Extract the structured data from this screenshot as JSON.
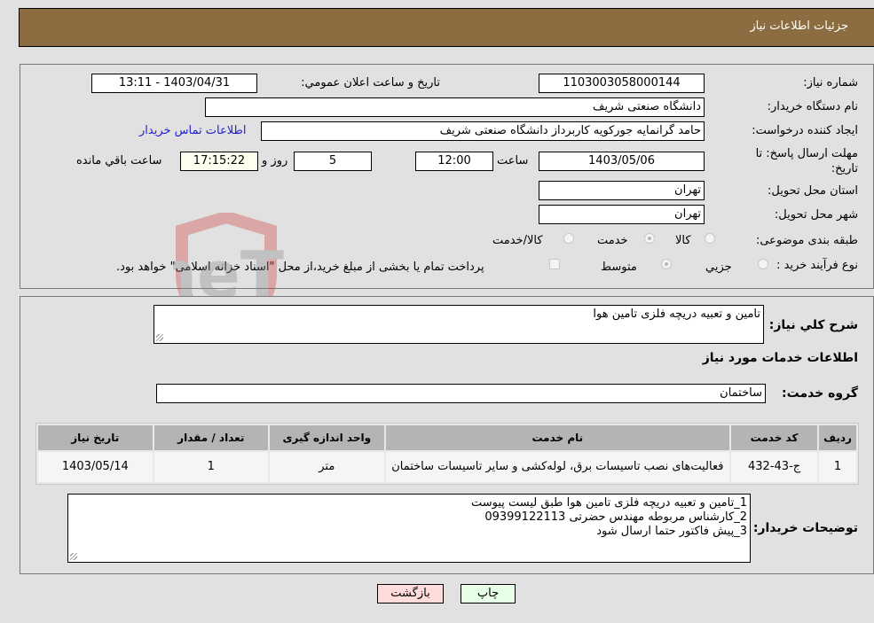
{
  "header": {
    "title": "جزئیات اطلاعات نیاز"
  },
  "details": {
    "need_number": {
      "label": "شماره نیاز:",
      "value": "1103003058000144"
    },
    "announce_datetime": {
      "label": "تاریخ و ساعت اعلان عمومي:",
      "value": "1403/04/31 - 13:11"
    },
    "buyer_org": {
      "label": "نام دستگاه خریدار:",
      "value": "دانشگاه صنعتی شریف"
    },
    "requester": {
      "label": "ایجاد کننده درخواست:",
      "value": "حامد گرانمایه جورکویه کاربرداز دانشگاه صنعتی شریف"
    },
    "buyer_contact_link": "اطلاعات تماس خریدار",
    "deadline": {
      "label": "مهلت ارسال پاسخ: تا تاریخ:",
      "date": "1403/05/06",
      "time_label": "ساعت",
      "time": "12:00",
      "days": "5",
      "days_label": "روز و",
      "remaining": "17:15:22",
      "remaining_label": "ساعت باقي مانده"
    },
    "province": {
      "label": "استان محل تحویل:",
      "value": "تهران"
    },
    "city": {
      "label": "شهر محل تحویل:",
      "value": "تهران"
    },
    "category": {
      "label": "طبقه بندی موضوعی:",
      "options": [
        "کالا",
        "خدمت",
        "کالا/خدمت"
      ],
      "selected": "خدمت"
    },
    "process": {
      "label": "نوع فرآیند خرید :",
      "options": [
        "جزيي",
        "متوسط"
      ],
      "selected": "متوسط",
      "treasury_note": "پرداخت تمام یا بخشی از مبلغ خرید،از محل \"اسناد خزانه اسلامی\" خواهد بود."
    }
  },
  "summary": {
    "label": "شرح کلي نیاز:",
    "value": "تامین و تعبیه دریچه فلزی تامین هوا"
  },
  "services": {
    "section_title": "اطلاعات خدمات مورد نیاز",
    "group_label": "گروه خدمت:",
    "group_value": "ساختمان",
    "columns": [
      "ردیف",
      "کد خدمت",
      "نام خدمت",
      "واحد اندازه گیری",
      "تعداد / مقدار",
      "تاریخ نیاز"
    ],
    "rows": [
      {
        "index": "1",
        "code": "ج-43-432",
        "name": "فعالیت‌های نصب تاسیسات برق، لوله‌کشی و سایر تاسیسات ساختمان",
        "unit": "متر",
        "quantity": "1",
        "date": "1403/05/14"
      }
    ]
  },
  "buyer_notes": {
    "label": "توضیحات خریدار:",
    "lines": [
      "1_تامین و تعبیه دریچه فلزی تامین هوا طبق لیست پیوست",
      "2_کارشناس مربوطه مهندس حضرتی 09399122113",
      "3_پیش فاکتور حتما ارسال شود"
    ]
  },
  "buttons": {
    "print": "چاپ",
    "back": "بازگشت"
  },
  "watermark": {
    "text": "AriaTender.neT"
  },
  "colors": {
    "header_bg": "#8c6d42",
    "back_bg": "#ffdcdc",
    "print_bg": "#e8ffe8",
    "link": "#2222cc"
  }
}
